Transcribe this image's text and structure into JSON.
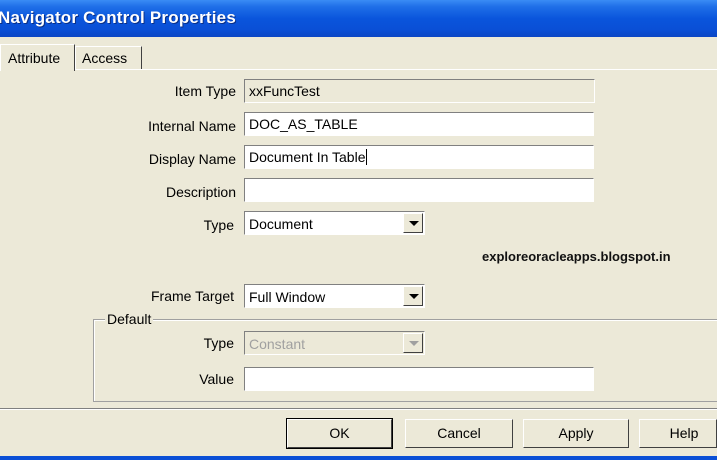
{
  "window": {
    "title": "Navigator Control Properties"
  },
  "tabs": [
    {
      "label": "Attribute"
    },
    {
      "label": "Access"
    }
  ],
  "form": {
    "item_type": {
      "label": "Item Type",
      "value": "xxFuncTest"
    },
    "internal_name": {
      "label": "Internal Name",
      "value": "DOC_AS_TABLE"
    },
    "display_name": {
      "label": "Display Name",
      "value": "Document In Table"
    },
    "description": {
      "label": "Description",
      "value": ""
    },
    "type": {
      "label": "Type",
      "value": "Document"
    },
    "frame_target": {
      "label": "Frame Target",
      "value": "Full Window"
    }
  },
  "watermark": "exploreoracleapps.blogspot.in",
  "default_group": {
    "label": "Default",
    "type": {
      "label": "Type",
      "value": "Constant"
    },
    "value": {
      "label": "Value",
      "value": ""
    }
  },
  "buttons": {
    "ok": "OK",
    "cancel": "Cancel",
    "apply": "Apply",
    "help": "Help"
  },
  "icons": {
    "dropdown": "chevron-down-icon"
  },
  "colors": {
    "titlebar": "#0a55dc",
    "dialog": "#ece9d8"
  }
}
